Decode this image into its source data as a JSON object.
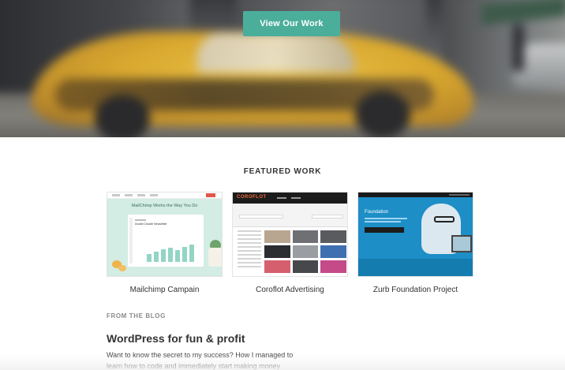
{
  "hero": {
    "cta_label": "View Our Work"
  },
  "featured": {
    "heading": "FEATURED WORK",
    "items": [
      {
        "caption": "Mailchimp Campain",
        "thumb_headline": "MailChimp Works the Way You Do",
        "thumb_panel_title": "Double Double Newsletter"
      },
      {
        "caption": "Coroflot Advertising",
        "thumb_logo": "COROFLOT"
      },
      {
        "caption": "Zurb Foundation Project",
        "thumb_title": "Foundation"
      }
    ]
  },
  "blog": {
    "label": "FROM THE BLOG",
    "post_title": "WordPress for fun & profit",
    "excerpt": "Want to know the secret to my success? How I managed to learn how to code and immediately start making money"
  },
  "colors": {
    "accent": "#4aae9b",
    "taxi": "#ebc247",
    "coroflot_orange": "#f06b3a",
    "zurb_blue": "#1d8ec6"
  }
}
